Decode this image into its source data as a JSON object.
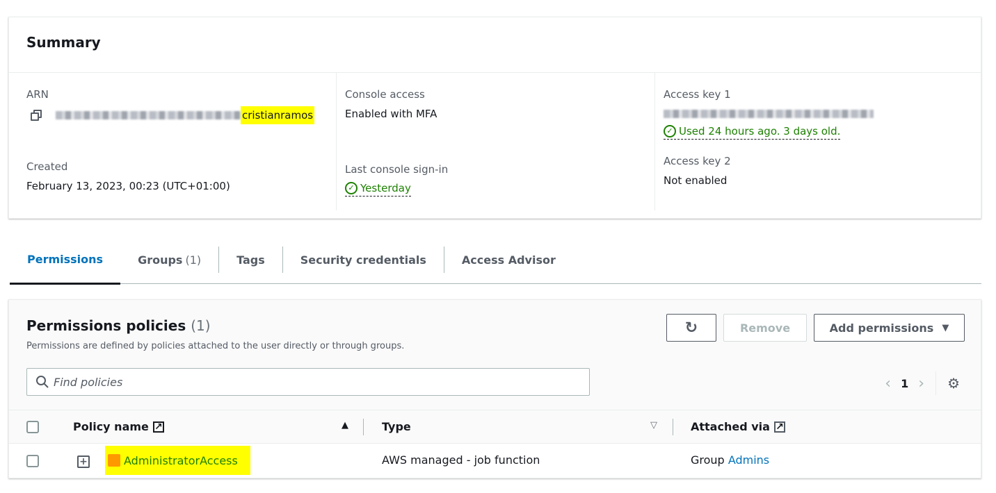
{
  "summary": {
    "title": "Summary",
    "arn": {
      "label": "ARN",
      "user": "cristianramos"
    },
    "created": {
      "label": "Created",
      "value": "February 13, 2023, 00:23 (UTC+01:00)"
    },
    "console_access": {
      "label": "Console access",
      "value": "Enabled with MFA"
    },
    "last_signin": {
      "label": "Last console sign-in",
      "value": "Yesterday"
    },
    "access_key_1": {
      "label": "Access key 1",
      "status": "Used 24 hours ago. 3 days old."
    },
    "access_key_2": {
      "label": "Access key 2",
      "value": "Not enabled"
    },
    "colors": {
      "success": "#1d8102",
      "highlight": "#ffff00"
    }
  },
  "tabs": [
    {
      "label": "Permissions",
      "active": true
    },
    {
      "label": "Groups",
      "count": "(1)"
    },
    {
      "label": "Tags"
    },
    {
      "label": "Security credentials"
    },
    {
      "label": "Access Advisor"
    }
  ],
  "policies": {
    "title": "Permissions policies",
    "count": "(1)",
    "description": "Permissions are defined by policies attached to the user directly or through groups.",
    "remove_label": "Remove",
    "add_label": "Add permissions",
    "search_placeholder": "Find policies",
    "page": "1",
    "columns": {
      "name": "Policy name",
      "type": "Type",
      "attached": "Attached via"
    },
    "rows": [
      {
        "name": "AdministratorAccess",
        "type": "AWS managed - job function",
        "attached_prefix": "Group",
        "attached_link": "Admins"
      }
    ]
  }
}
